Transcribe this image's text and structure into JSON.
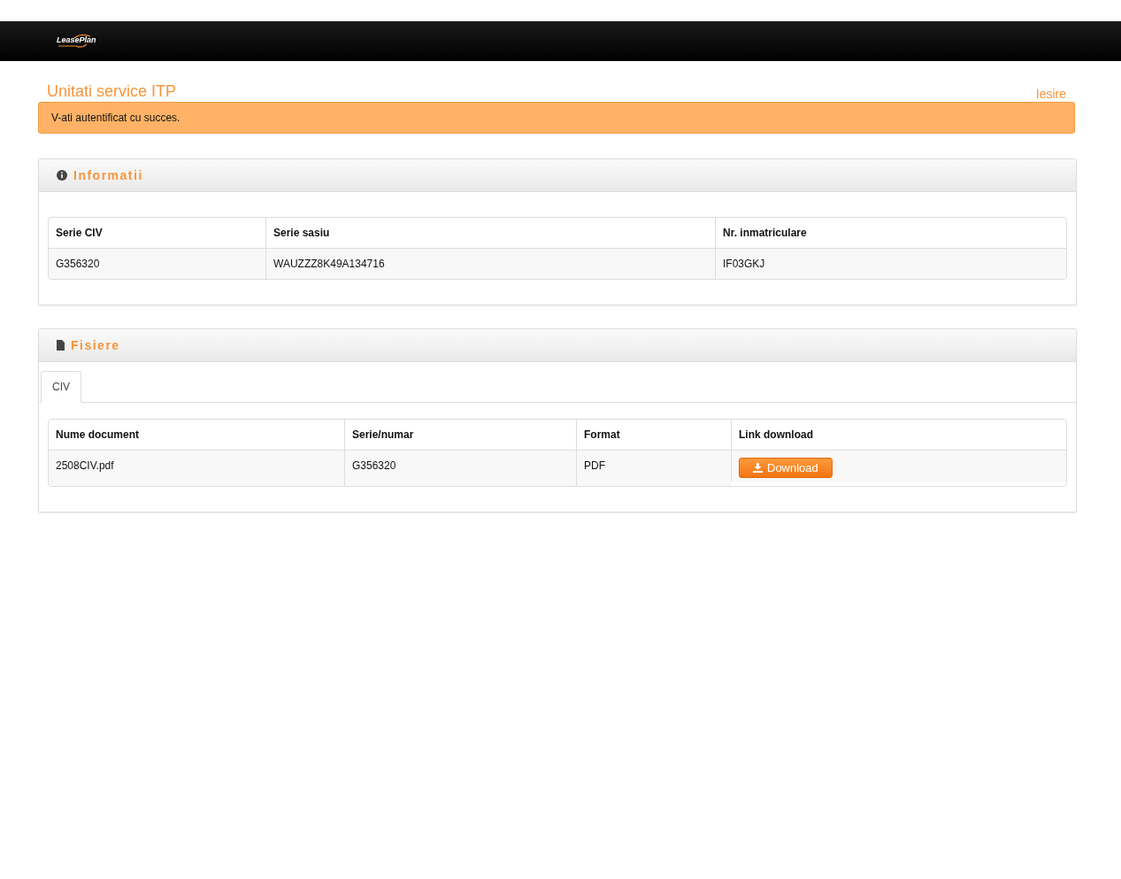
{
  "header": {
    "logo": "LeasePlan"
  },
  "page": {
    "title": "Unitati service ITP",
    "logout": "Iesire"
  },
  "alert": {
    "message": "V-ati autentificat cu succes."
  },
  "info_panel": {
    "title": "Informatii",
    "table": {
      "columns": [
        "Serie CIV",
        "Serie sasiu",
        "Nr. inmatriculare"
      ],
      "rows": [
        [
          "G356320",
          "WAUZZZ8K49A134716",
          "IF03GKJ"
        ]
      ]
    }
  },
  "files_panel": {
    "title": "Fisiere",
    "tabs": [
      {
        "label": "CIV",
        "selected": true
      }
    ],
    "table": {
      "columns": [
        "Nume document",
        "Serie/numar",
        "Format",
        "Link download"
      ],
      "rows": [
        {
          "name": "2508CIV.pdf",
          "serial": "G356320",
          "format": "PDF",
          "download": "Download"
        }
      ]
    }
  }
}
